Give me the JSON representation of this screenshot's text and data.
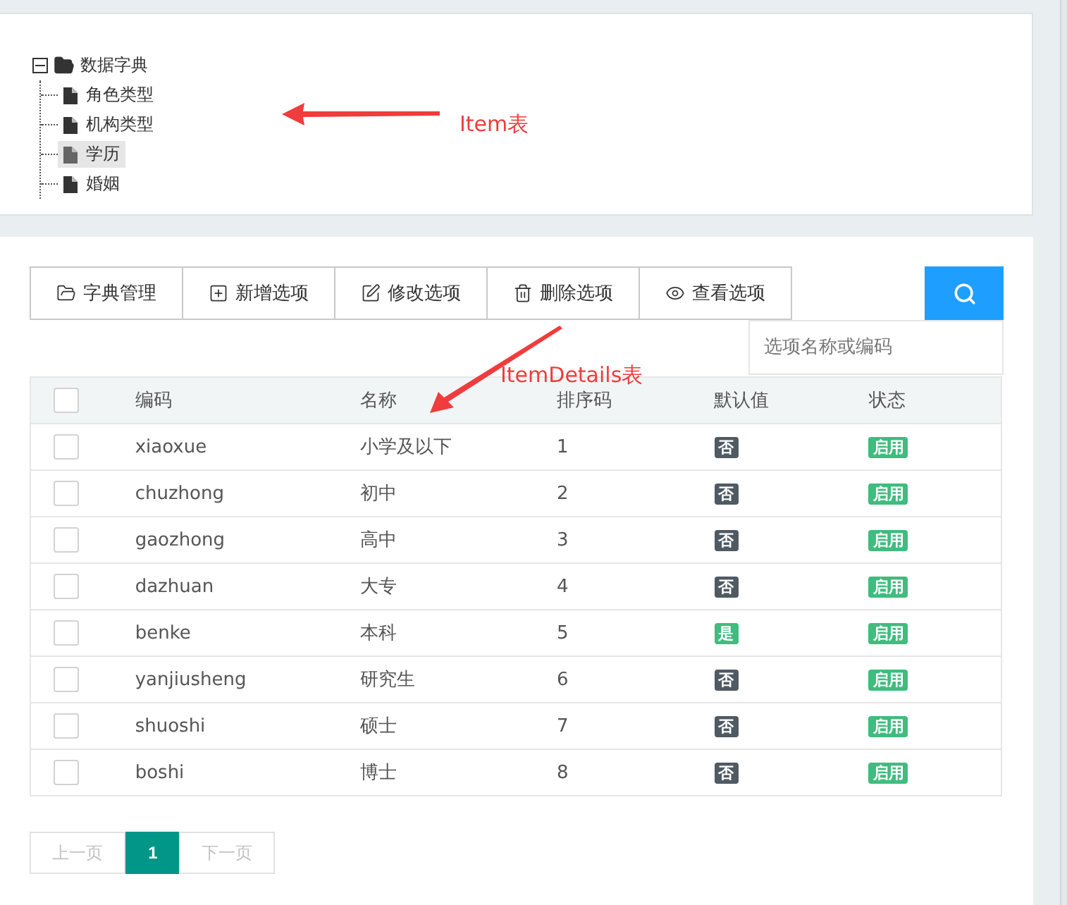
{
  "tree": {
    "label": "数据字典",
    "expanded": true,
    "children": [
      {
        "label": "角色类型",
        "selected": false
      },
      {
        "label": "机构类型",
        "selected": false
      },
      {
        "label": "学历",
        "selected": true
      },
      {
        "label": "婚姻",
        "selected": false
      }
    ]
  },
  "annotations": [
    {
      "text": "Item表"
    },
    {
      "text": "ItemDetails表"
    }
  ],
  "toolbar": [
    {
      "label": "字典管理",
      "kind": "folder"
    },
    {
      "label": "新增选项",
      "kind": "plus"
    },
    {
      "label": "修改选项",
      "kind": "edit"
    },
    {
      "label": "删除选项",
      "kind": "trash"
    },
    {
      "label": "查看选项",
      "kind": "eye"
    }
  ],
  "search": {
    "placeholder": "选项名称或编码"
  },
  "table": {
    "select_all_checked": false,
    "columns": [
      "编码",
      "名称",
      "排序码",
      "默认值",
      "状态"
    ],
    "rows": [
      {
        "checked": false,
        "code": "xiaoxue",
        "name": "小学及以下",
        "order": "1",
        "default": {
          "text": "否",
          "on": false
        },
        "status": {
          "text": "启用",
          "on": true
        }
      },
      {
        "checked": false,
        "code": "chuzhong",
        "name": "初中",
        "order": "2",
        "default": {
          "text": "否",
          "on": false
        },
        "status": {
          "text": "启用",
          "on": true
        }
      },
      {
        "checked": false,
        "code": "gaozhong",
        "name": "高中",
        "order": "3",
        "default": {
          "text": "否",
          "on": false
        },
        "status": {
          "text": "启用",
          "on": true
        }
      },
      {
        "checked": false,
        "code": "dazhuan",
        "name": "大专",
        "order": "4",
        "default": {
          "text": "否",
          "on": false
        },
        "status": {
          "text": "启用",
          "on": true
        }
      },
      {
        "checked": false,
        "code": "benke",
        "name": "本科",
        "order": "5",
        "default": {
          "text": "是",
          "on": true
        },
        "status": {
          "text": "启用",
          "on": true
        }
      },
      {
        "checked": false,
        "code": "yanjiusheng",
        "name": "研究生",
        "order": "6",
        "default": {
          "text": "否",
          "on": false
        },
        "status": {
          "text": "启用",
          "on": true
        }
      },
      {
        "checked": false,
        "code": "shuoshi",
        "name": "硕士",
        "order": "7",
        "default": {
          "text": "否",
          "on": false
        },
        "status": {
          "text": "启用",
          "on": true
        }
      },
      {
        "checked": false,
        "code": "boshi",
        "name": "博士",
        "order": "8",
        "default": {
          "text": "否",
          "on": false
        },
        "status": {
          "text": "启用",
          "on": true
        }
      }
    ]
  },
  "pagination": {
    "prev": "上一页",
    "pages": [
      {
        "label": "1",
        "selected": true
      }
    ],
    "next": "下一页"
  }
}
